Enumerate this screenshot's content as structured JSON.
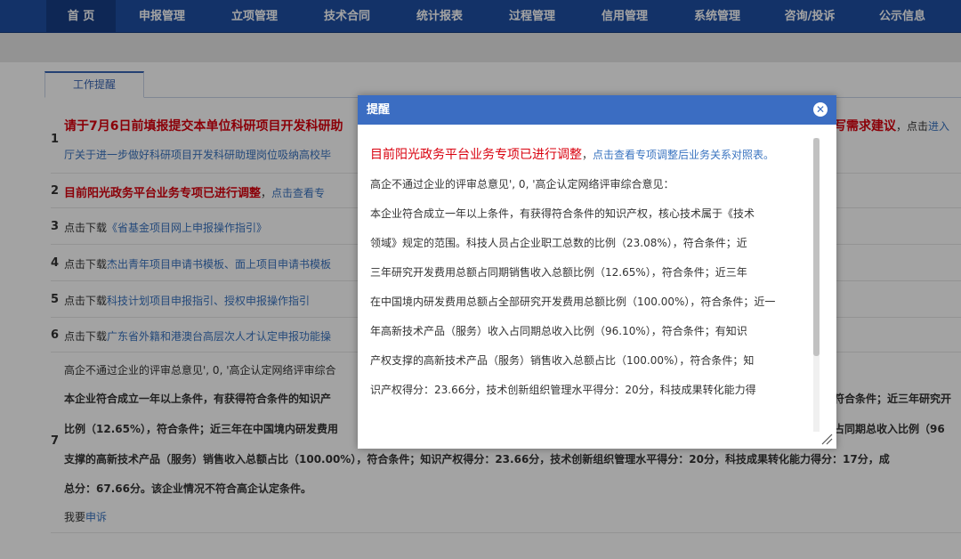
{
  "nav": {
    "items": [
      "首 页",
      "申报管理",
      "立项管理",
      "技术合同",
      "统计报表",
      "过程管理",
      "信用管理",
      "系统管理",
      "咨询/投诉",
      "公示信息"
    ]
  },
  "tab": {
    "label": "工作提醒"
  },
  "rows": {
    "r1": {
      "num": "1",
      "line1": "请于7月6日前填报提交本单位科研项目开发科研助",
      "line1_right": "写需求建议",
      "line1_tail": "，点击",
      "line1_link": "进入",
      "line2": "厅关于进一步做好科研项目开发科研助理岗位吸纳高校毕"
    },
    "r2": {
      "num": "2",
      "title": "目前阳光政务平台业务专项已进行调整",
      "sep": "，",
      "link": "点击查看专"
    },
    "r3": {
      "num": "3",
      "prefix": "点击下载",
      "link": "《省基金项目网上申报操作指引》"
    },
    "r4": {
      "num": "4",
      "prefix": "点击下载",
      "link": "杰出青年项目申请书模板、面上项目申请书模板"
    },
    "r5": {
      "num": "5",
      "prefix": "点击下载",
      "link": "科技计划项目申报指引、授权申报操作指引"
    },
    "r6": {
      "num": "6",
      "prefix": "点击下载",
      "link": "广东省外籍和港澳台高层次人才认定申报功能操"
    },
    "r7": {
      "num": "7",
      "line1": "高企不通过企业的评审总意见', 0, '高企认定网络评审综合",
      "line2": "本企业符合成立一年以上条件，有获得符合条件的知识产",
      "line2_right": "符合条件；近三年研究开",
      "line3": "比例（12.65%），符合条件；近三年在中国境内研发费用",
      "line3_right": "占同期总收入比例（96",
      "line4": "支撑的高新技术产品（服务）销售收入总额占比（100.00%），符合条件；知识产权得分：23.66分，技术创新组织管理水平得分：20分，科技成果转化能力得分：17分，成",
      "line5": "总分：67.66分。该企业情况不符合高企认定条件。",
      "complain_prefix": "我要",
      "complain_link": "申诉"
    }
  },
  "modal": {
    "title": "提醒",
    "close_icon": "close-icon",
    "headline": "目前阳光政务平台业务专项已进行调整",
    "sep": "，",
    "link": "点击查看专项调整后业务关系对照表。",
    "p1": "高企不通过企业的评审总意见', 0, '高企认定网络评审综合意见：",
    "p2_l1": "本企业符合成立一年以上条件，有获得符合条件的知识产权，核心技术属于《技术",
    "p2_l2": "领域》规定的范围。科技人员占企业职工总数的比例（23.08%），符合条件；近",
    "p2_l3": "三年研究开发费用总额占同期销售收入总额比例（12.65%），符合条件；近三年",
    "p2_l4": "在中国境内研发费用总额占全部研究开发费用总额比例（100.00%），符合条件；近一",
    "p2_l5": "年高新技术产品（服务）收入占同期总收入比例（96.10%），符合条件；有知识",
    "p2_l6": "产权支撑的高新技术产品（服务）销售收入总额占比（100.00%），符合条件；知",
    "p2_l7": "识产权得分：23.66分，技术创新组织管理水平得分：20分，科技成果转化能力得"
  }
}
